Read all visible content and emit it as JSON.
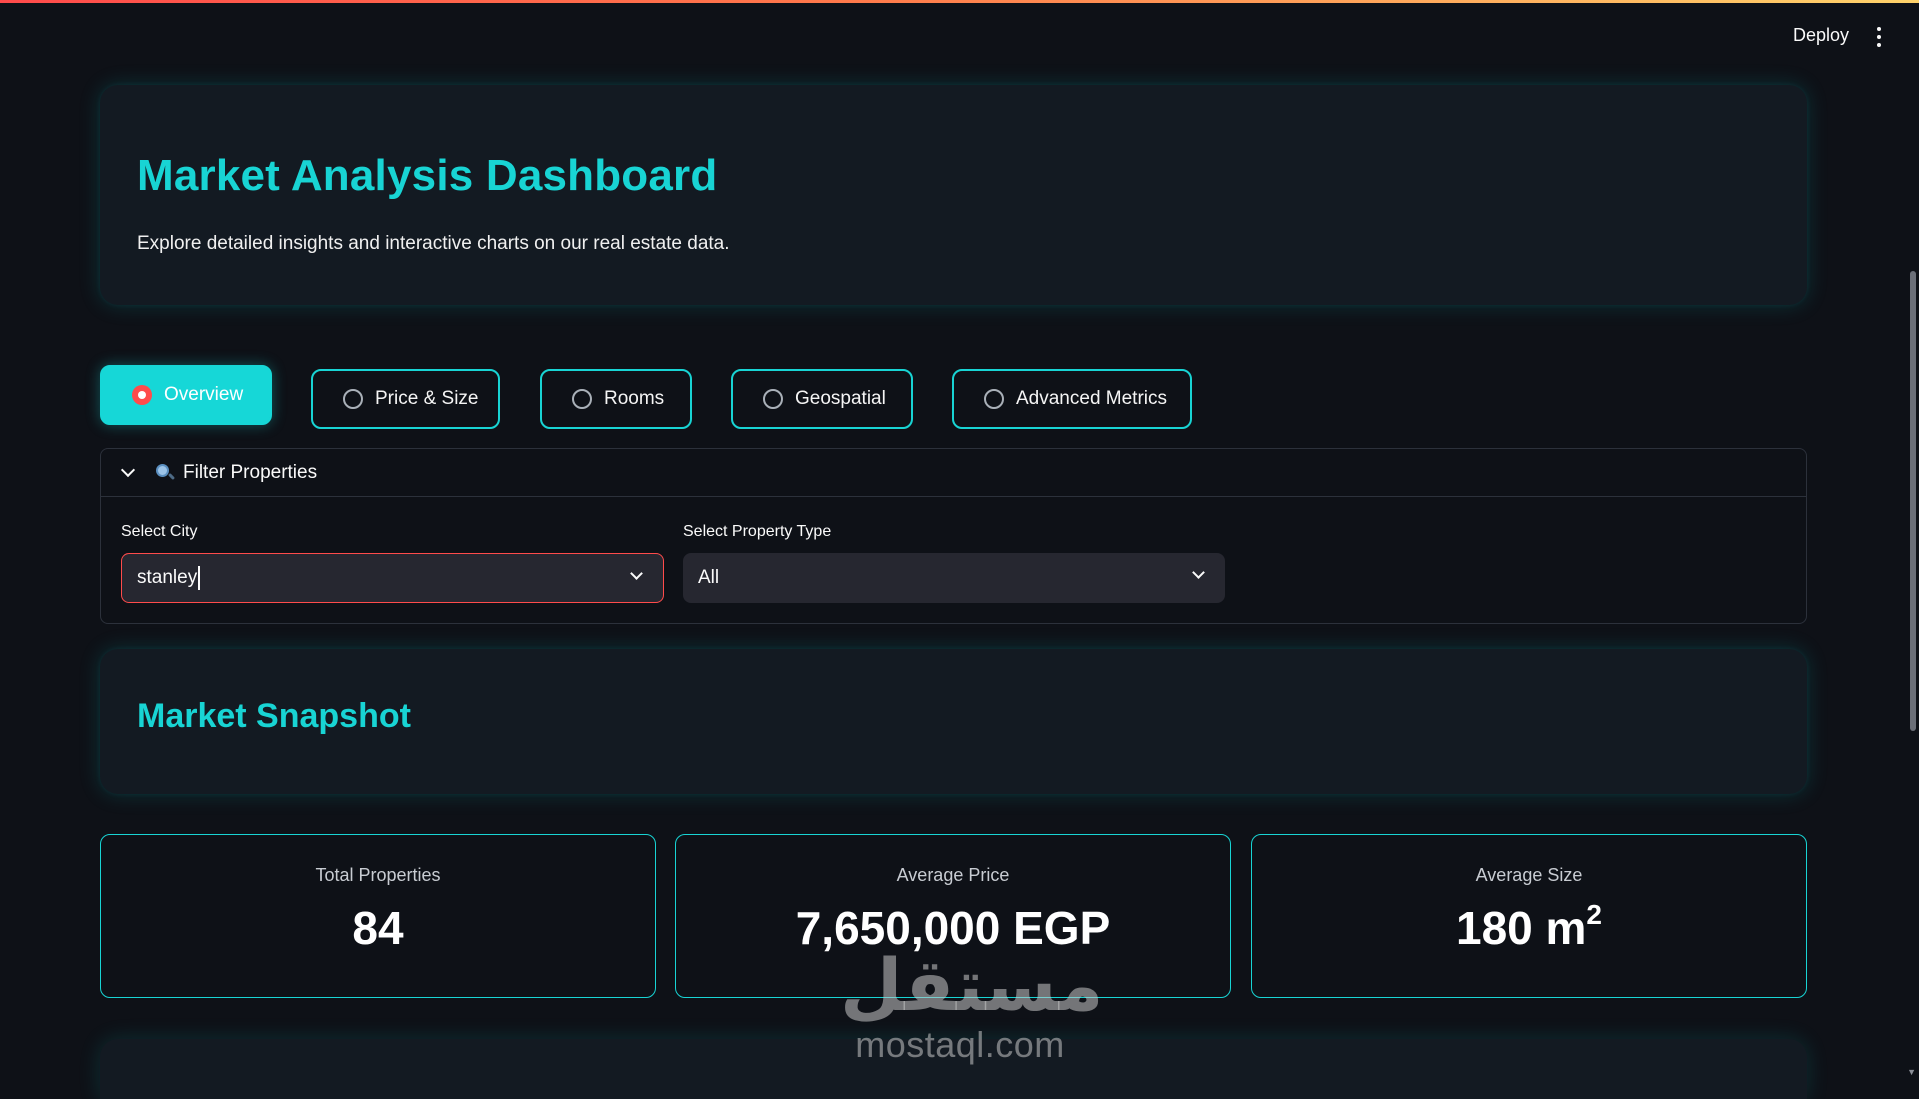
{
  "app": {
    "deploy_label": "Deploy",
    "menu_icon": "three-dots-vertical-icon",
    "accent_color": "#18d4d4",
    "focus_color": "#ff4b4b"
  },
  "hero": {
    "title": "Market Analysis Dashboard",
    "subtitle": "Explore detailed insights and interactive charts on our real estate data."
  },
  "tabs": [
    {
      "label": "Overview",
      "selected": true
    },
    {
      "label": "Price & Size",
      "selected": false
    },
    {
      "label": "Rooms",
      "selected": false
    },
    {
      "label": "Geospatial",
      "selected": false
    },
    {
      "label": "Advanced Metrics",
      "selected": false
    }
  ],
  "filter": {
    "title": "Filter Properties",
    "icon": "search-icon",
    "city_label": "Select City",
    "city_value": "stanley",
    "property_type_label": "Select Property Type",
    "property_type_value": "All"
  },
  "snapshot": {
    "title": "Market Snapshot"
  },
  "metrics": [
    {
      "label": "Total Properties",
      "value": "84"
    },
    {
      "label": "Average Price",
      "value": "7,650,000 EGP"
    },
    {
      "label": "Average Size",
      "value": "180 m",
      "unit_sup": "2"
    }
  ],
  "watermark": {
    "logo_text": "مستقل",
    "site": "mostaql.com"
  }
}
